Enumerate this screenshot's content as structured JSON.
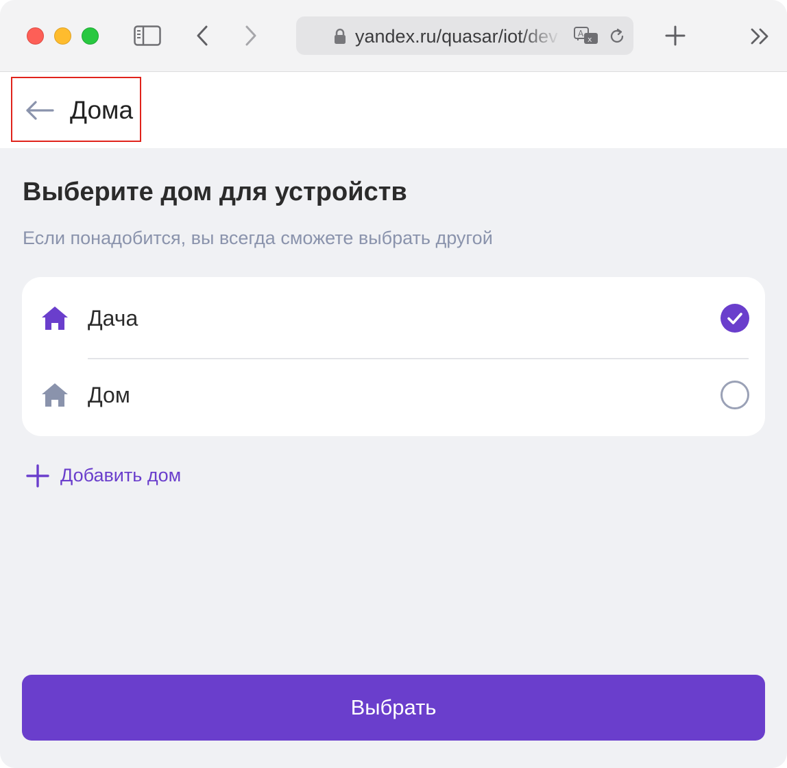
{
  "browser": {
    "url": "yandex.ru/quasar/iot/dev",
    "icons": {
      "traffic_close": "close-traffic-light",
      "traffic_minimize": "minimize-traffic-light",
      "traffic_zoom": "zoom-traffic-light",
      "sidebar": "sidebar-icon",
      "back": "chevron-left-icon",
      "forward": "chevron-right-icon",
      "lock": "lock-icon",
      "translate": "translate-icon",
      "reload": "reload-icon",
      "new_tab": "plus-icon",
      "more": "double-chevron-right-icon"
    }
  },
  "header": {
    "title": "Дома",
    "back_icon": "arrow-left-icon"
  },
  "main": {
    "heading": "Выберите дом для устройств",
    "subheading": "Если понадобится, вы всегда сможете выбрать другой",
    "homes": [
      {
        "label": "Дача",
        "selected": true,
        "icon": "home-icon"
      },
      {
        "label": "Дом",
        "selected": false,
        "icon": "home-icon"
      }
    ],
    "add_home_label": "Добавить дом",
    "submit_label": "Выбрать"
  },
  "colors": {
    "accent": "#6a3ecc",
    "page_background": "#f0f1f4",
    "subtle_text": "#8a93ac",
    "inactive_icon": "#8a93ac",
    "highlight_box": "#e0231b"
  }
}
